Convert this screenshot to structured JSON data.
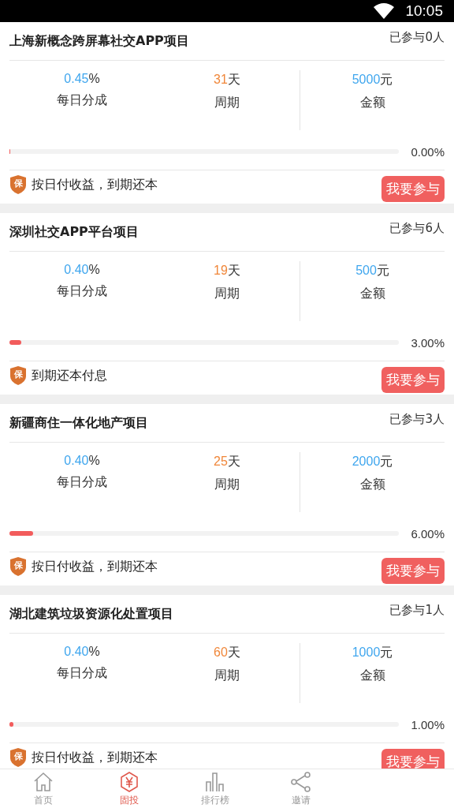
{
  "status_bar": {
    "time": "10:05"
  },
  "projects": [
    {
      "title": "上海新概念跨屏幕社交APP项目",
      "participants": "已参与0人",
      "rate": "0.45",
      "rate_unit": "%",
      "rate_label": "每日分成",
      "period": "31",
      "period_unit": "天",
      "period_label": "周期",
      "amount": "5000",
      "amount_unit": "元",
      "amount_label": "金额",
      "level": 0.0,
      "progress": "0.00%",
      "badge": "保",
      "terms": "按日付收益，到期还本",
      "button": "我要参与"
    },
    {
      "title": "深圳社交APP平台项目",
      "participants": "已参与6人",
      "rate": "0.40",
      "rate_unit": "%",
      "rate_label": "每日分成",
      "period": "19",
      "period_unit": "天",
      "period_label": "周期",
      "amount": "500",
      "amount_unit": "元",
      "amount_label": "金额",
      "level": 0.03,
      "progress": "3.00%",
      "badge": "保",
      "terms": "到期还本付息",
      "button": "我要参与"
    },
    {
      "title": "新疆商住一体化地产项目",
      "participants": "已参与3人",
      "rate": "0.40",
      "rate_unit": "%",
      "rate_label": "每日分成",
      "period": "25",
      "period_unit": "天",
      "period_label": "周期",
      "amount": "2000",
      "amount_unit": "元",
      "amount_label": "金额",
      "level": 0.06,
      "progress": "6.00%",
      "badge": "保",
      "terms": "按日付收益，到期还本",
      "button": "我要参与"
    },
    {
      "title": "湖北建筑垃圾资源化处置项目",
      "participants": "已参与1人",
      "rate": "0.40",
      "rate_unit": "%",
      "rate_label": "每日分成",
      "period": "60",
      "period_unit": "天",
      "period_label": "周期",
      "amount": "1000",
      "amount_unit": "元",
      "amount_label": "金额",
      "level": 0.01,
      "progress": "1.00%",
      "badge": "保",
      "terms": "按日付收益，到期还本",
      "button": "我要参与"
    }
  ],
  "nav": [
    {
      "kind": "home",
      "label": "首页",
      "selected": false
    },
    {
      "kind": "yen",
      "label": "固投",
      "selected": true
    },
    {
      "kind": "chart",
      "label": "排行榜",
      "selected": false
    },
    {
      "kind": "share",
      "label": "邀请",
      "selected": false
    }
  ]
}
